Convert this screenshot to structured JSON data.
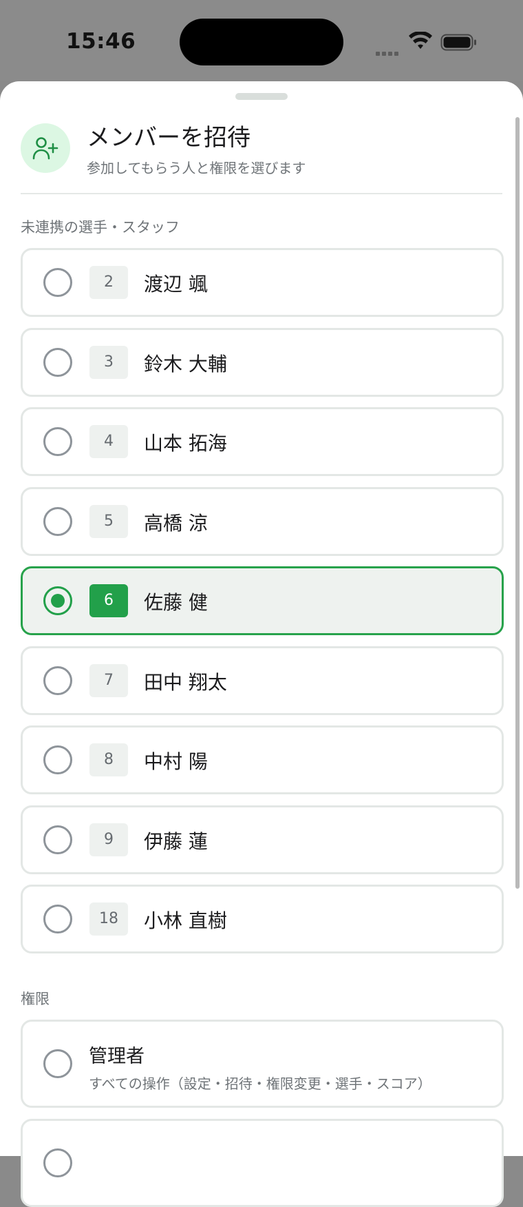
{
  "status_bar": {
    "time": "15:46"
  },
  "header": {
    "title": "メンバーを招待",
    "subtitle": "参加してもらう人と権限を選びます",
    "icon": "user-plus-icon"
  },
  "members_section": {
    "label": "未連携の選手・スタッフ",
    "items": [
      {
        "number": "2",
        "name": "渡辺 颯",
        "selected": false
      },
      {
        "number": "3",
        "name": "鈴木 大輔",
        "selected": false
      },
      {
        "number": "4",
        "name": "山本 拓海",
        "selected": false
      },
      {
        "number": "5",
        "name": "高橋 涼",
        "selected": false
      },
      {
        "number": "6",
        "name": "佐藤 健",
        "selected": true
      },
      {
        "number": "7",
        "name": "田中 翔太",
        "selected": false
      },
      {
        "number": "8",
        "name": "中村 陽",
        "selected": false
      },
      {
        "number": "9",
        "name": "伊藤 蓮",
        "selected": false
      },
      {
        "number": "18",
        "name": "小林 直樹",
        "selected": false
      }
    ]
  },
  "permissions_section": {
    "label": "権限",
    "items": [
      {
        "title": "管理者",
        "description": "すべての操作（設定・招待・権限変更・選手・スコア）",
        "selected": false
      },
      {
        "title": "",
        "description": "",
        "selected": false
      }
    ]
  },
  "colors": {
    "accent": "#22a04a",
    "selected_background": "#eef2ef",
    "border": "#e3e7e5",
    "avatar_background": "#dcf7e3"
  }
}
